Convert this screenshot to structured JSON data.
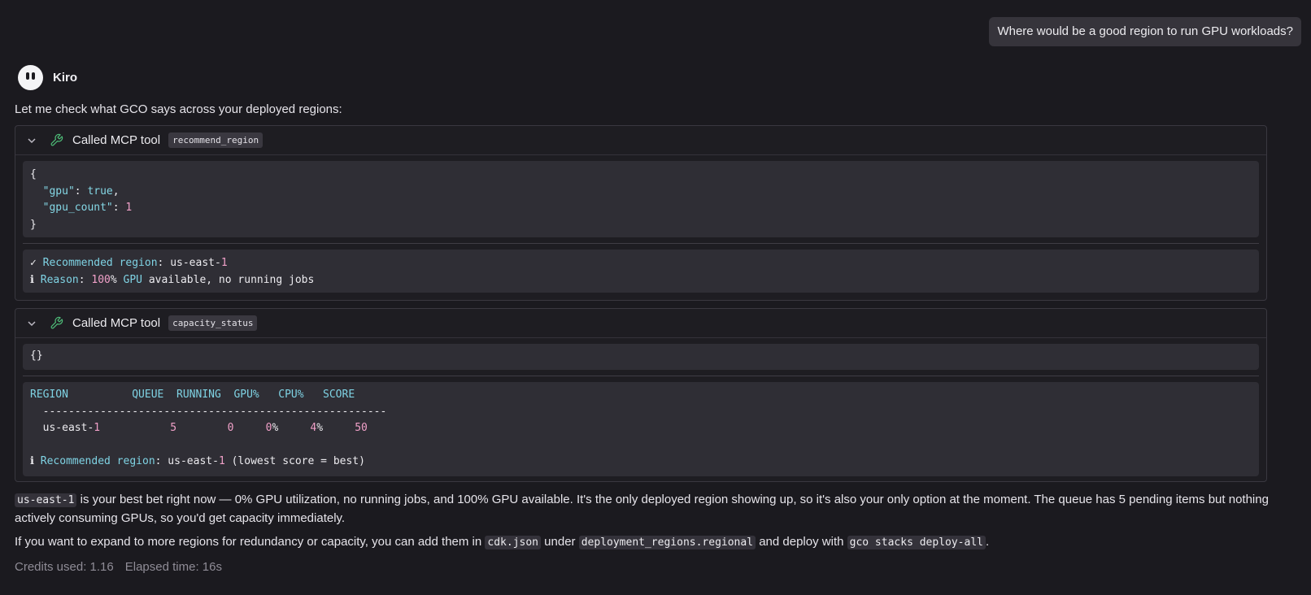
{
  "user_message": "Where would be a good region to run GPU workloads?",
  "assistant": {
    "name": "Kiro",
    "intro": "Let me check what GCO says across your deployed regions:"
  },
  "tool_calls": [
    {
      "label": "Called MCP tool",
      "tool": "recommend_region",
      "input_lines": [
        "{",
        "  \"gpu\": true,",
        "  \"gpu_count\": 1",
        "}"
      ],
      "output": {
        "recommended_prefix": "✓ ",
        "recommended_label": "Recommended region",
        "recommended_value": "us-east-1",
        "reason_prefix": "ℹ ",
        "reason_label": "Reason",
        "reason_value": "100% GPU available, no running jobs"
      }
    },
    {
      "label": "Called MCP tool",
      "tool": "capacity_status",
      "input": "{}",
      "output": {
        "columns": [
          "REGION",
          "QUEUE",
          "RUNNING",
          "GPU%",
          "CPU%",
          "SCORE"
        ],
        "divider": "------------------------------------------------------",
        "rows": [
          {
            "region": "us-east-1",
            "queue": "5",
            "running": "0",
            "gpu": "0%",
            "cpu": "4%",
            "score": "50"
          }
        ],
        "note_prefix": "ℹ ",
        "note_label": "Recommended region",
        "note_value": "us-east-1 (lowest score = best)"
      }
    }
  ],
  "answer": {
    "p1_code": "us-east-1",
    "p1_text": " is your best bet right now — 0% GPU utilization, no running jobs, and 100% GPU available. It's the only deployed region showing up, so it's also your only option at the moment. The queue has 5 pending items but nothing actively consuming GPUs, so you'd get capacity immediately.",
    "p2_a": "If you want to expand to more regions for redundancy or capacity, you can add them in ",
    "p2_code1": "cdk.json",
    "p2_b": " under ",
    "p2_code2": "deployment_regions.regional",
    "p2_c": " and deploy with ",
    "p2_code3": "gco stacks deploy-all",
    "p2_d": "."
  },
  "footer": {
    "credits": "Credits used: 1.16",
    "elapsed": "Elapsed time: 16s"
  },
  "colors": {
    "background": "#1b1a1f",
    "key_cyan": "#85d8e6",
    "number_pink": "#f0a0c8",
    "wrench_green": "#4fc07a"
  }
}
